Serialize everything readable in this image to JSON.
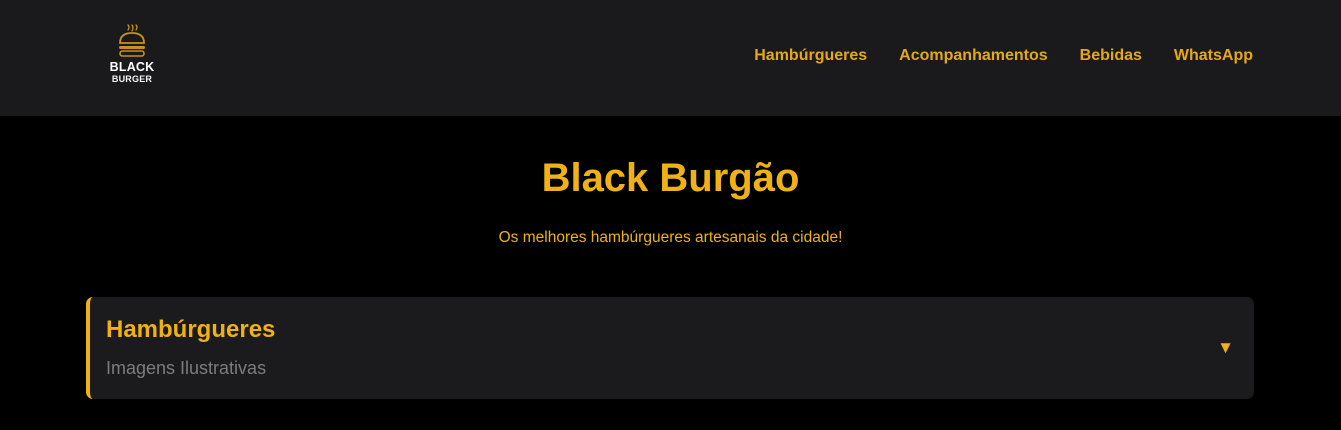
{
  "header": {
    "logo": {
      "line1": "BLACK",
      "line2": "BURGER",
      "icon": "burger-icon"
    },
    "nav": [
      {
        "label": "Hambúrgueres"
      },
      {
        "label": "Acompanhamentos"
      },
      {
        "label": "Bebidas"
      },
      {
        "label": "WhatsApp"
      }
    ]
  },
  "hero": {
    "title": "Black Burgão",
    "subtitle": "Os melhores hambúrgueres artesanais da cidade!"
  },
  "sections": [
    {
      "title": "Hambúrgueres",
      "subtitle": "Imagens Ilustrativas",
      "toggle_icon": "chevron-down-icon",
      "toggle_glyph": "▼"
    }
  ],
  "colors": {
    "accent": "#efb114",
    "header_bg": "#1a1a1c",
    "page_bg": "#000000",
    "card_bg": "#1b1b1d",
    "muted_text": "#7c7c80"
  }
}
